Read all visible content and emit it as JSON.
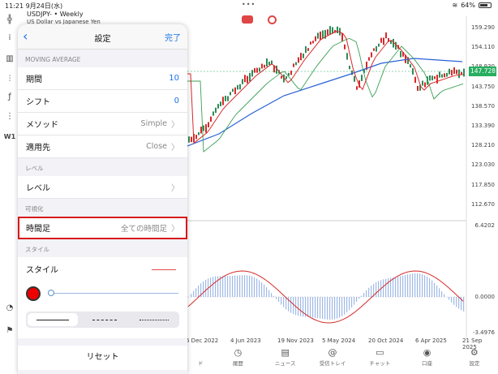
{
  "status": {
    "time": "11:21",
    "date": "9月24日(水)",
    "dots": "•••",
    "battery": "64%"
  },
  "chart": {
    "symbol": "USDJPY- • Weekly",
    "symbol_desc": "US Dollar vs Japanese Yen",
    "current_price": "147.728",
    "price_axis": [
      "159.290",
      "154.110",
      "148.930",
      "143.750",
      "138.570",
      "133.390",
      "128.210",
      "123.030",
      "117.850",
      "112.670"
    ],
    "macd_axis": [
      "6.4202",
      "0.0000",
      "-3.4976"
    ],
    "date_axis": [
      "6 Dec 2022",
      "4 Jun 2023",
      "19 Nov 2023",
      "5 May 2024",
      "20 Oct 2024",
      "6 Apr 2025",
      "21 Sep 2025"
    ]
  },
  "tabs": [
    {
      "icon": "history-icon",
      "label": "履歴"
    },
    {
      "icon": "news-icon",
      "label": "ニュース"
    },
    {
      "icon": "mail-icon",
      "label": "受信トレイ"
    },
    {
      "icon": "chat-icon",
      "label": "チャット"
    },
    {
      "icon": "account-icon",
      "label": "口座"
    },
    {
      "icon": "settings-icon",
      "label": "設定"
    }
  ],
  "tab_partial": "ド",
  "panel": {
    "title": "設定",
    "back": "‹",
    "done": "完了",
    "section_ma": "MOVING AVERAGE",
    "period_label": "期間",
    "period_value": "10",
    "shift_label": "シフト",
    "shift_value": "0",
    "method_label": "メソッド",
    "method_value": "Simple",
    "apply_label": "適用先",
    "apply_value": "Close",
    "section_level": "レベル",
    "level_label": "レベル",
    "section_vis": "可視化",
    "timeframe_label": "時間足",
    "timeframe_value": "全ての時間足",
    "section_style": "スタイル",
    "style_label": "スタイル",
    "reset": "リセット",
    "accent": "#1a73e8",
    "highlight": "#d61a1a"
  },
  "lefttools": [
    "╬",
    "⁞",
    "▥",
    "⫶",
    "ƒ",
    "⋮",
    "W1"
  ]
}
